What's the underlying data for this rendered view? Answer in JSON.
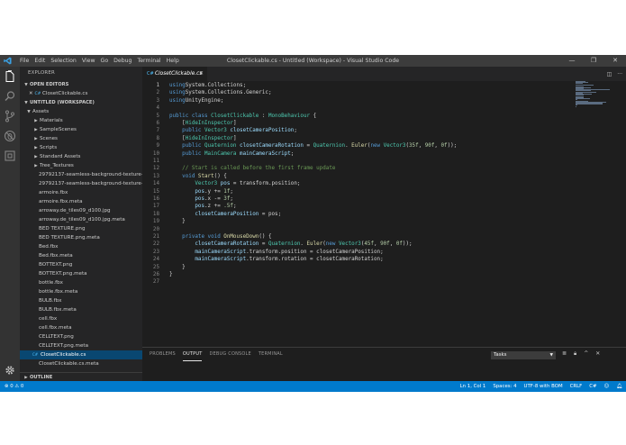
{
  "titlebar": {
    "menus": [
      "File",
      "Edit",
      "Selection",
      "View",
      "Go",
      "Debug",
      "Terminal",
      "Help"
    ],
    "title": "ClosetClickable.cs - Untitled (Workspace) - Visual Studio Code",
    "controls": [
      "—",
      "❐",
      "✕"
    ]
  },
  "sidebar": {
    "header": "EXPLORER",
    "open_editors_label": "OPEN EDITORS",
    "open_editors": [
      {
        "name": "ClosetClickable.cs"
      }
    ],
    "workspace_label": "UNTITLED (WORKSPACE)",
    "outline_label": "OUTLINE",
    "tree": [
      {
        "name": "Assets",
        "depth": 0,
        "kind": "folder",
        "open": true
      },
      {
        "name": "Materials",
        "depth": 1,
        "kind": "folder"
      },
      {
        "name": "SampleScenes",
        "depth": 1,
        "kind": "folder"
      },
      {
        "name": "Scenes",
        "depth": 1,
        "kind": "folder"
      },
      {
        "name": "Scripts",
        "depth": 1,
        "kind": "folder"
      },
      {
        "name": "Standard Assets",
        "depth": 1,
        "kind": "folder"
      },
      {
        "name": "Tree_Textures",
        "depth": 1,
        "kind": "folder"
      },
      {
        "name": "29792137-seamless-background-texture-o...",
        "depth": 1,
        "kind": "file"
      },
      {
        "name": "29792137-seamless-background-texture-o...",
        "depth": 1,
        "kind": "file"
      },
      {
        "name": "armoire.fbx",
        "depth": 1,
        "kind": "file"
      },
      {
        "name": "armoire.fbx.meta",
        "depth": 1,
        "kind": "file"
      },
      {
        "name": "arroway.de_tiles09_d100.jpg",
        "depth": 1,
        "kind": "file"
      },
      {
        "name": "arroway.de_tiles09_d100.jpg.meta",
        "depth": 1,
        "kind": "file"
      },
      {
        "name": "BED TEXTURE.png",
        "depth": 1,
        "kind": "file"
      },
      {
        "name": "BED TEXTURE.png.meta",
        "depth": 1,
        "kind": "file"
      },
      {
        "name": "Bed.fbx",
        "depth": 1,
        "kind": "file"
      },
      {
        "name": "Bed.fbx.meta",
        "depth": 1,
        "kind": "file"
      },
      {
        "name": "BOTTEXT.png",
        "depth": 1,
        "kind": "file"
      },
      {
        "name": "BOTTEXT.png.meta",
        "depth": 1,
        "kind": "file"
      },
      {
        "name": "bottle.fbx",
        "depth": 1,
        "kind": "file"
      },
      {
        "name": "bottle.fbx.meta",
        "depth": 1,
        "kind": "file"
      },
      {
        "name": "BULB.fbx",
        "depth": 1,
        "kind": "file"
      },
      {
        "name": "BULB.fbx.meta",
        "depth": 1,
        "kind": "file"
      },
      {
        "name": "cell.fbx",
        "depth": 1,
        "kind": "file"
      },
      {
        "name": "cell.fbx.meta",
        "depth": 1,
        "kind": "file"
      },
      {
        "name": "CELLTEXT.png",
        "depth": 1,
        "kind": "file"
      },
      {
        "name": "CELLTEXT.png.meta",
        "depth": 1,
        "kind": "file"
      },
      {
        "name": "ClosetClickable.cs",
        "depth": 1,
        "kind": "cs",
        "selected": true
      },
      {
        "name": "ClosetClickable.cs.meta",
        "depth": 1,
        "kind": "file"
      }
    ]
  },
  "editor": {
    "tab_label": "ClosetClickable.cs",
    "current_line": 1,
    "lines": [
      [
        [
          "kw",
          "using"
        ],
        [
          "",
          "System.Collections;"
        ]
      ],
      [
        [
          "kw",
          "using"
        ],
        [
          "",
          "System.Collections.Generic;"
        ]
      ],
      [
        [
          "kw",
          "using"
        ],
        [
          "",
          "UnityEngine;"
        ]
      ],
      [],
      [
        [
          "kw",
          "public class"
        ],
        [
          "ty",
          "ClosetClickable"
        ],
        [
          "",
          " : "
        ],
        [
          "ty",
          "MonoBehaviour"
        ],
        [
          "",
          " {"
        ]
      ],
      [
        [
          "",
          "    ["
        ],
        [
          "ty",
          "HideInInspector"
        ],
        [
          "",
          "]"
        ]
      ],
      [
        [
          "kw",
          "    public"
        ],
        [
          "ty",
          "Vector3"
        ],
        [
          "vr",
          "closetCameraPosition"
        ],
        [
          "",
          ";"
        ]
      ],
      [
        [
          "",
          "    ["
        ],
        [
          "ty",
          "HideInInspector"
        ],
        [
          "",
          "]"
        ]
      ],
      [
        [
          "kw",
          "    public"
        ],
        [
          "ty",
          "Quaternion"
        ],
        [
          "vr",
          "closetCameraRotation"
        ],
        [
          "",
          " = "
        ],
        [
          "ty",
          "Quaternion"
        ],
        [
          "",
          ". "
        ],
        [
          "fn",
          "Euler"
        ],
        [
          "",
          "("
        ],
        [
          "kw",
          "new"
        ],
        [
          "ty",
          "Vector3"
        ],
        [
          "",
          "("
        ],
        [
          "nm",
          "35f"
        ],
        [
          "",
          ", "
        ],
        [
          "nm",
          "90f"
        ],
        [
          "",
          ", "
        ],
        [
          "nm",
          "0f"
        ],
        [
          "",
          "));"
        ]
      ],
      [
        [
          "kw",
          "    public"
        ],
        [
          "ty",
          "MainCamera"
        ],
        [
          "vr",
          "mainCameraScript"
        ],
        [
          "",
          ";"
        ]
      ],
      [],
      [
        [
          "cm",
          "    // Start is called before the first frame update"
        ]
      ],
      [
        [
          "kw",
          "    void"
        ],
        [
          "fn",
          "Start"
        ],
        [
          "",
          "() {"
        ]
      ],
      [
        [
          "ty",
          "        Vector3"
        ],
        [
          "vr",
          "pos"
        ],
        [
          "",
          " = transform.position;"
        ]
      ],
      [
        [
          "vr",
          "        pos"
        ],
        [
          "",
          ".y += "
        ],
        [
          "nm",
          "1f"
        ],
        [
          "",
          ";"
        ]
      ],
      [
        [
          "vr",
          "        pos"
        ],
        [
          "",
          ".x -= "
        ],
        [
          "nm",
          "3f"
        ],
        [
          "",
          ";"
        ]
      ],
      [
        [
          "vr",
          "        pos"
        ],
        [
          "",
          ".z += "
        ],
        [
          "nm",
          ".5f"
        ],
        [
          "",
          ";"
        ]
      ],
      [
        [
          "vr",
          "        closetCameraPosition"
        ],
        [
          "",
          " = pos;"
        ]
      ],
      [
        [
          "",
          "    }"
        ]
      ],
      [],
      [
        [
          "kw",
          "    private void"
        ],
        [
          "fn",
          "OnMouseDown"
        ],
        [
          "",
          "() {"
        ]
      ],
      [
        [
          "vr",
          "        closetCameraRotation"
        ],
        [
          "",
          " = "
        ],
        [
          "ty",
          "Quaternion"
        ],
        [
          "",
          ". "
        ],
        [
          "fn",
          "Euler"
        ],
        [
          "",
          "("
        ],
        [
          "kw",
          "new"
        ],
        [
          "ty",
          "Vector3"
        ],
        [
          "",
          "("
        ],
        [
          "nm",
          "45f"
        ],
        [
          "",
          ", "
        ],
        [
          "nm",
          "90f"
        ],
        [
          "",
          ", "
        ],
        [
          "nm",
          "0f"
        ],
        [
          "",
          "));"
        ]
      ],
      [
        [
          "vr",
          "        mainCameraScript"
        ],
        [
          "",
          ".transform.position = closetCameraPosition;"
        ]
      ],
      [
        [
          "vr",
          "        mainCameraScript"
        ],
        [
          "",
          ".transform.rotation = closetCameraRotation;"
        ]
      ],
      [
        [
          "",
          "    }"
        ]
      ],
      [
        [
          "",
          "}"
        ]
      ],
      []
    ]
  },
  "panel": {
    "tabs": [
      "PROBLEMS",
      "OUTPUT",
      "DEBUG CONSOLE",
      "TERMINAL"
    ],
    "active_tab": "OUTPUT",
    "task_select": "Tasks"
  },
  "statusbar": {
    "left": "⊗ 0  ⚠ 0",
    "right": [
      "Ln 1, Col 1",
      "Spaces: 4",
      "UTF-8 with BOM",
      "CRLF",
      "C#"
    ]
  },
  "colors": {
    "accent": "#007acc",
    "editor_bg": "#1e1e1e",
    "sidebar_bg": "#252526",
    "selection": "#094771"
  }
}
